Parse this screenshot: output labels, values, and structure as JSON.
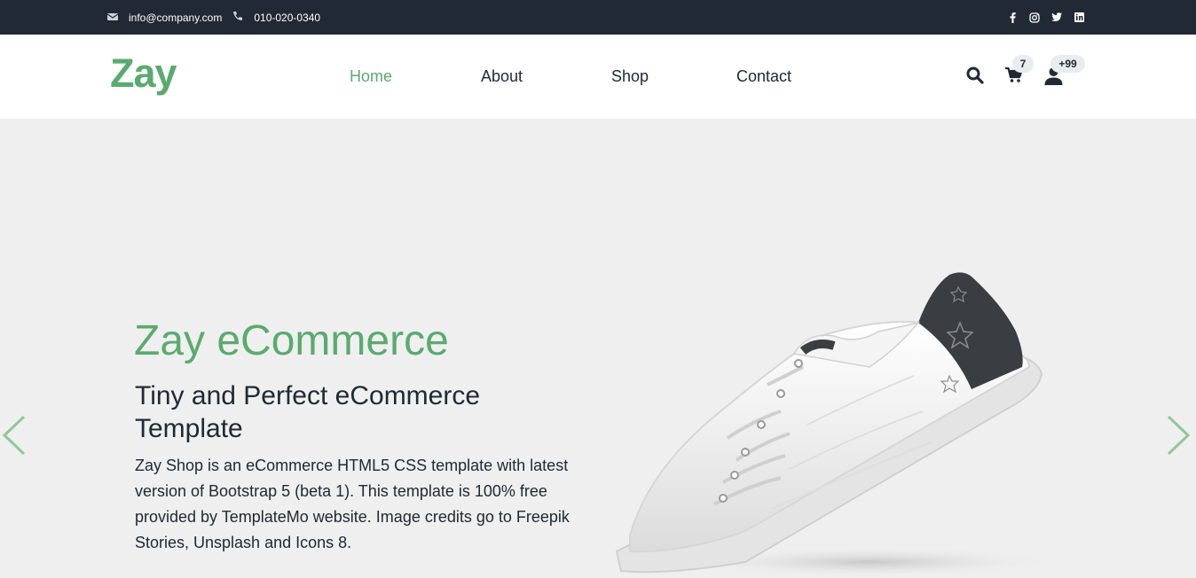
{
  "topbar": {
    "email": "info@company.com",
    "phone": "010-020-0340",
    "social": [
      "facebook-icon",
      "instagram-icon",
      "twitter-icon",
      "linkedin-icon"
    ]
  },
  "navbar": {
    "logo": "Zay",
    "menu": [
      {
        "label": "Home",
        "active": true
      },
      {
        "label": "About",
        "active": false
      },
      {
        "label": "Shop",
        "active": false
      },
      {
        "label": "Contact",
        "active": false
      }
    ],
    "cart_count": "7",
    "user_count": "+99"
  },
  "hero": {
    "title_bold": "Zay",
    "title_light": "eCommerce",
    "subtitle": "Tiny and Perfect eCommerce Template",
    "description": "Zay Shop is an eCommerce HTML5 CSS template with latest version of Bootstrap 5 (beta 1). This template is 100% free provided by TemplateMo website. Image credits go to Freepik Stories, Unsplash and Icons 8."
  },
  "colors": {
    "brand": "#59ab6e",
    "dark": "#212934",
    "hero_bg": "#efefef"
  }
}
